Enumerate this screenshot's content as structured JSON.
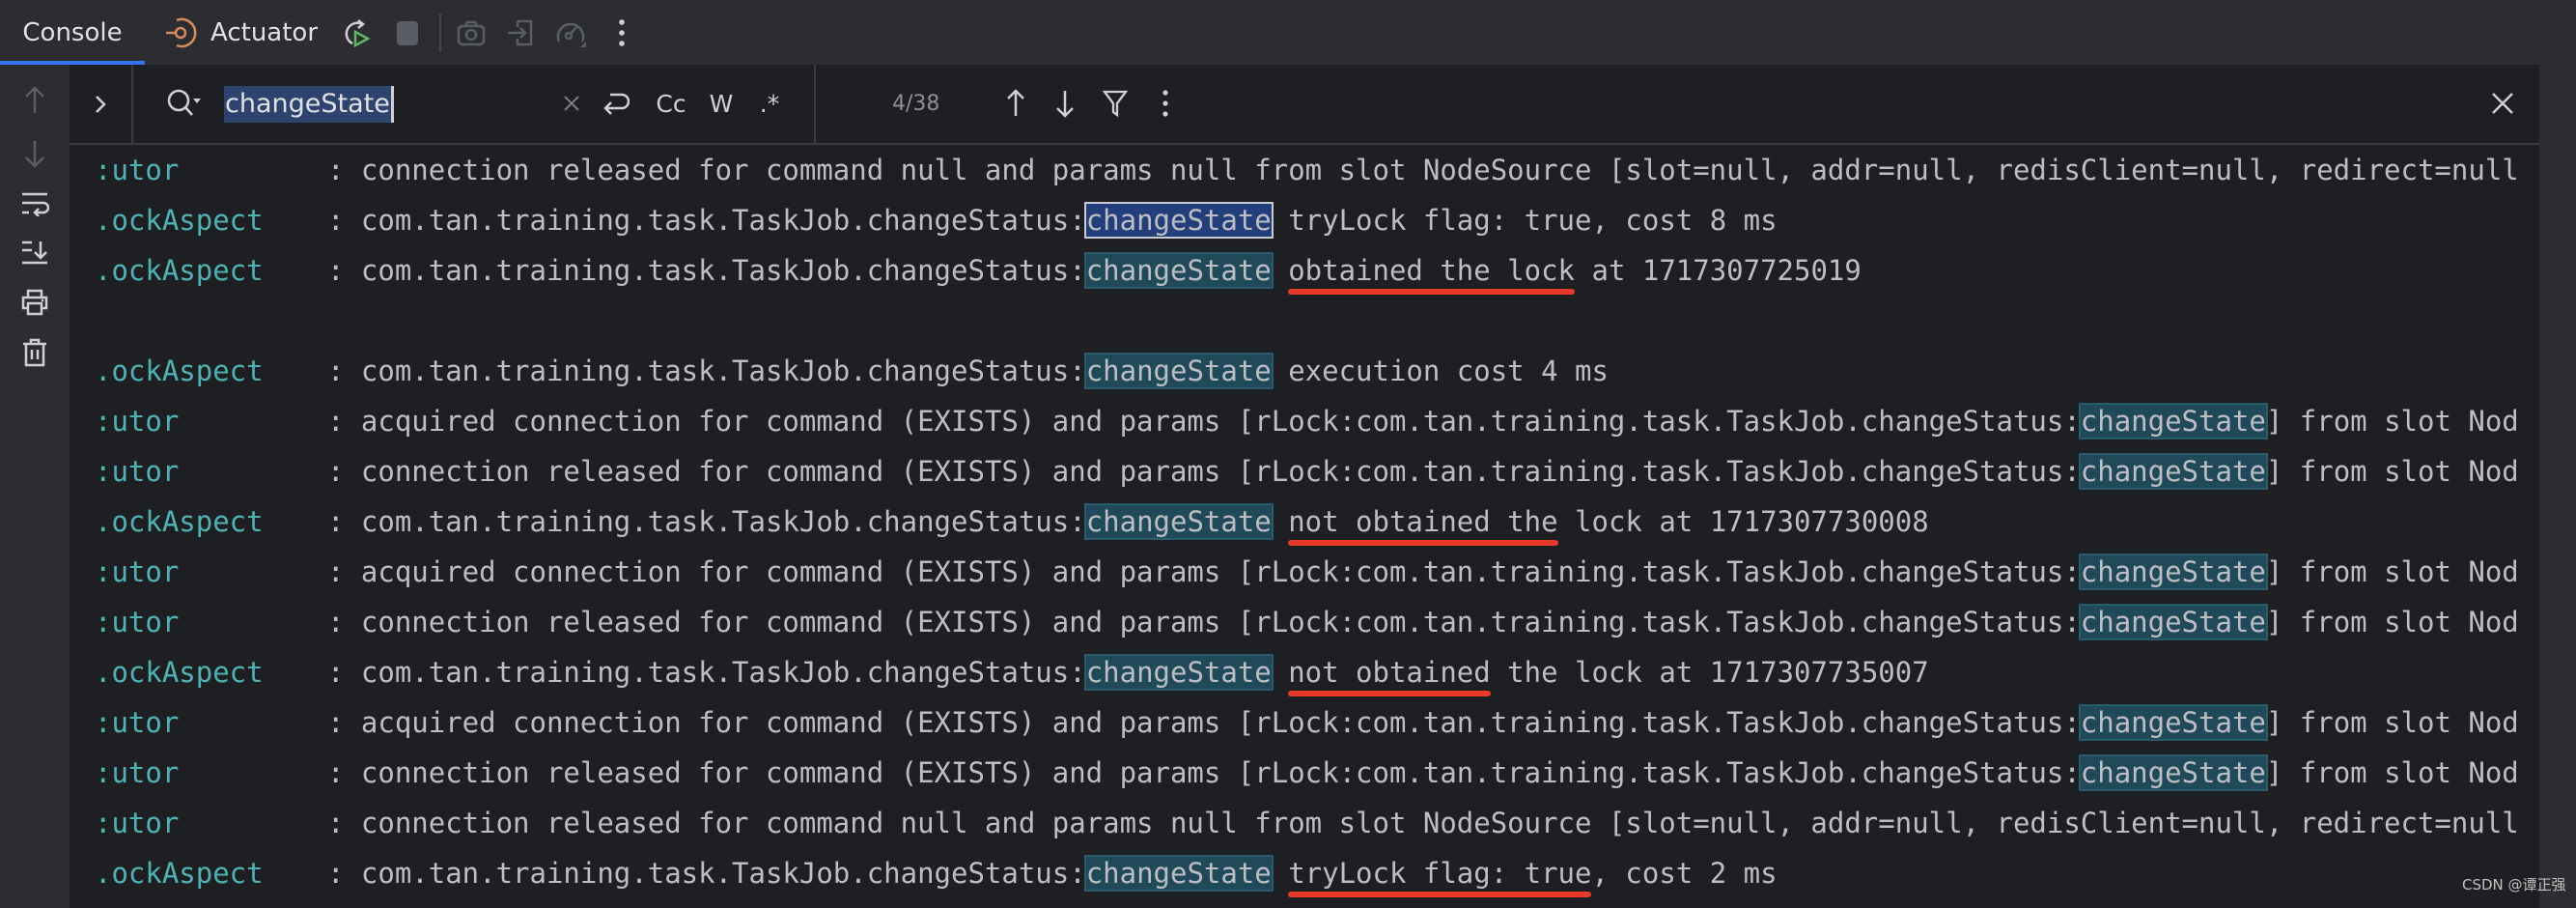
{
  "tabs": {
    "console": "Console",
    "actuator": "Actuator"
  },
  "toolbar": {
    "icons": [
      "rerun-icon",
      "stop-icon",
      "camera-icon",
      "login-icon",
      "dashboard-icon",
      "more-vertical-icon"
    ]
  },
  "gutter": {
    "icons": [
      "arrow-up-icon",
      "arrow-down-icon",
      "soft-wrap-icon",
      "scroll-to-end-icon",
      "print-icon",
      "trash-icon"
    ]
  },
  "search": {
    "value": "changeState",
    "options": {
      "case": "Cc",
      "words": "W",
      "regex": ".*"
    },
    "match_count": "4/38"
  },
  "colors": {
    "accent": "#3574f0",
    "logger": "#4fb3b3",
    "annotation_underline": "#e8392a",
    "match_highlight": "#20495a",
    "current_match": "#233e7a"
  },
  "log": {
    "rows": [
      {
        "logger": ":utor",
        "pre": ": connection released for command null and params null from slot NodeSource [slot=null, addr=null, redisClient=null, redirect=null",
        "match": "",
        "post": ""
      },
      {
        "logger": ".ockAspect",
        "pre": ": com.tan.training.task.TaskJob.changeStatus:",
        "match": "changeState",
        "post": " tryLock flag: true, cost 8 ms",
        "current": true
      },
      {
        "logger": ".ockAspect",
        "pre": ": com.tan.training.task.TaskJob.changeStatus:",
        "match": "changeState",
        "post": " obtained the lock at 1717307725019"
      },
      {
        "logger": "",
        "pre": "",
        "match": "",
        "post": ""
      },
      {
        "logger": ".ockAspect",
        "pre": ": com.tan.training.task.TaskJob.changeStatus:",
        "match": "changeState",
        "post": " execution cost 4 ms"
      },
      {
        "logger": ":utor",
        "pre": ": acquired connection for command (EXISTS) and params [rLock:com.tan.training.task.TaskJob.changeStatus:",
        "match": "changeState",
        "post": "] from slot Nod"
      },
      {
        "logger": ":utor",
        "pre": ": connection released for command (EXISTS) and params [rLock:com.tan.training.task.TaskJob.changeStatus:",
        "match": "changeState",
        "post": "] from slot Nod"
      },
      {
        "logger": ".ockAspect",
        "pre": ": com.tan.training.task.TaskJob.changeStatus:",
        "match": "changeState",
        "post": " not obtained the lock at 1717307730008"
      },
      {
        "logger": ":utor",
        "pre": ": acquired connection for command (EXISTS) and params [rLock:com.tan.training.task.TaskJob.changeStatus:",
        "match": "changeState",
        "post": "] from slot Nod"
      },
      {
        "logger": ":utor",
        "pre": ": connection released for command (EXISTS) and params [rLock:com.tan.training.task.TaskJob.changeStatus:",
        "match": "changeState",
        "post": "] from slot Nod"
      },
      {
        "logger": ".ockAspect",
        "pre": ": com.tan.training.task.TaskJob.changeStatus:",
        "match": "changeState",
        "post": " not obtained the lock at 1717307735007"
      },
      {
        "logger": ":utor",
        "pre": ": acquired connection for command (EXISTS) and params [rLock:com.tan.training.task.TaskJob.changeStatus:",
        "match": "changeState",
        "post": "] from slot Nod"
      },
      {
        "logger": ":utor",
        "pre": ": connection released for command (EXISTS) and params [rLock:com.tan.training.task.TaskJob.changeStatus:",
        "match": "changeState",
        "post": "] from slot Nod"
      },
      {
        "logger": ":utor",
        "pre": ": connection released for command null and params null from slot NodeSource [slot=null, addr=null, redisClient=null, redirect=null",
        "match": "",
        "post": ""
      },
      {
        "logger": ".ockAspect",
        "pre": ": com.tan.training.task.TaskJob.changeStatus:",
        "match": "changeState",
        "post": " tryLock flag: true, cost 2 ms"
      }
    ]
  },
  "annotations": [
    {
      "row": 2,
      "text": "obtained the lock"
    },
    {
      "row": 7,
      "text": "not obtained the"
    },
    {
      "row": 10,
      "text": "not obtained"
    },
    {
      "row": 14,
      "text": "tryLock flag: true"
    }
  ],
  "watermark": "CSDN @谭正强"
}
